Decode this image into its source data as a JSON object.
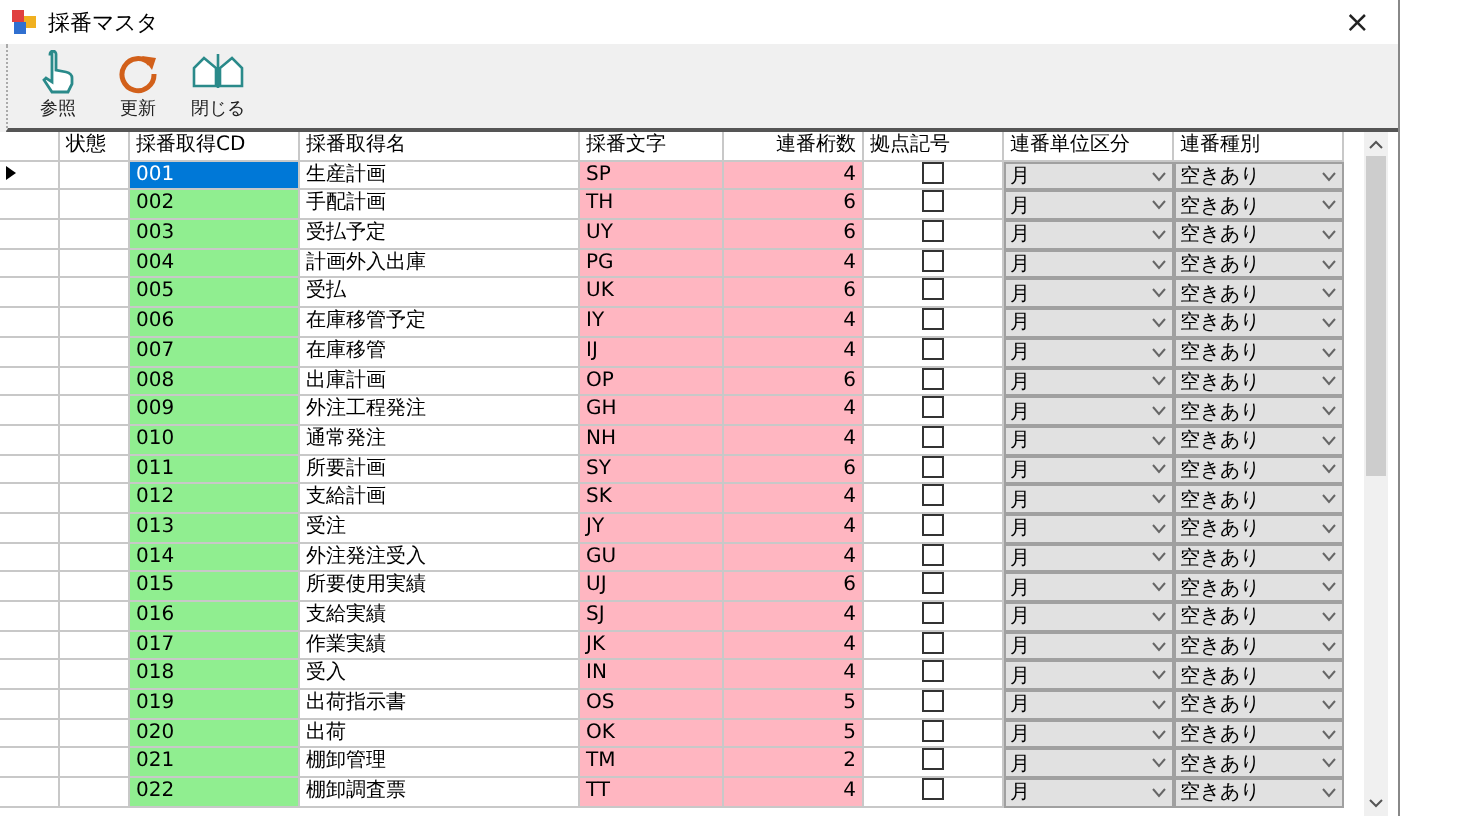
{
  "window": {
    "title": "採番マスタ",
    "close": "×"
  },
  "toolbar": [
    {
      "kind": "pointer",
      "label": "参照"
    },
    {
      "kind": "refresh",
      "label": "更新"
    },
    {
      "kind": "close",
      "label": "閉じる"
    }
  ],
  "table": {
    "columns": [
      "状態",
      "採番取得CD",
      "採番取得名",
      "採番文字",
      "連番桁数",
      "拠点記号",
      "連番単位区分",
      "連番種別"
    ],
    "rows": [
      {
        "selected": true,
        "code": "001",
        "name": "生産計画",
        "prefix": "SP",
        "digits": "4",
        "checked": false,
        "unit": "月",
        "type": "空きあり"
      },
      {
        "selected": false,
        "code": "002",
        "name": "手配計画",
        "prefix": "TH",
        "digits": "6",
        "checked": false,
        "unit": "月",
        "type": "空きあり"
      },
      {
        "selected": false,
        "code": "003",
        "name": "受払予定",
        "prefix": "UY",
        "digits": "6",
        "checked": false,
        "unit": "月",
        "type": "空きあり"
      },
      {
        "selected": false,
        "code": "004",
        "name": "計画外入出庫",
        "prefix": "PG",
        "digits": "4",
        "checked": false,
        "unit": "月",
        "type": "空きあり"
      },
      {
        "selected": false,
        "code": "005",
        "name": "受払",
        "prefix": "UK",
        "digits": "6",
        "checked": false,
        "unit": "月",
        "type": "空きあり"
      },
      {
        "selected": false,
        "code": "006",
        "name": "在庫移管予定",
        "prefix": "IY",
        "digits": "4",
        "checked": false,
        "unit": "月",
        "type": "空きあり"
      },
      {
        "selected": false,
        "code": "007",
        "name": "在庫移管",
        "prefix": "IJ",
        "digits": "4",
        "checked": false,
        "unit": "月",
        "type": "空きあり"
      },
      {
        "selected": false,
        "code": "008",
        "name": "出庫計画",
        "prefix": "OP",
        "digits": "6",
        "checked": false,
        "unit": "月",
        "type": "空きあり"
      },
      {
        "selected": false,
        "code": "009",
        "name": "外注工程発注",
        "prefix": "GH",
        "digits": "4",
        "checked": false,
        "unit": "月",
        "type": "空きあり"
      },
      {
        "selected": false,
        "code": "010",
        "name": "通常発注",
        "prefix": "NH",
        "digits": "4",
        "checked": false,
        "unit": "月",
        "type": "空きあり"
      },
      {
        "selected": false,
        "code": "011",
        "name": "所要計画",
        "prefix": "SY",
        "digits": "6",
        "checked": false,
        "unit": "月",
        "type": "空きあり"
      },
      {
        "selected": false,
        "code": "012",
        "name": "支給計画",
        "prefix": "SK",
        "digits": "4",
        "checked": false,
        "unit": "月",
        "type": "空きあり"
      },
      {
        "selected": false,
        "code": "013",
        "name": "受注",
        "prefix": "JY",
        "digits": "4",
        "checked": false,
        "unit": "月",
        "type": "空きあり"
      },
      {
        "selected": false,
        "code": "014",
        "name": "外注発注受入",
        "prefix": "GU",
        "digits": "4",
        "checked": false,
        "unit": "月",
        "type": "空きあり"
      },
      {
        "selected": false,
        "code": "015",
        "name": "所要使用実績",
        "prefix": "UJ",
        "digits": "6",
        "checked": false,
        "unit": "月",
        "type": "空きあり"
      },
      {
        "selected": false,
        "code": "016",
        "name": "支給実績",
        "prefix": "SJ",
        "digits": "4",
        "checked": false,
        "unit": "月",
        "type": "空きあり"
      },
      {
        "selected": false,
        "code": "017",
        "name": "作業実績",
        "prefix": "JK",
        "digits": "4",
        "checked": false,
        "unit": "月",
        "type": "空きあり"
      },
      {
        "selected": false,
        "code": "018",
        "name": "受入",
        "prefix": "IN",
        "digits": "4",
        "checked": false,
        "unit": "月",
        "type": "空きあり"
      },
      {
        "selected": false,
        "code": "019",
        "name": "出荷指示書",
        "prefix": "OS",
        "digits": "5",
        "checked": false,
        "unit": "月",
        "type": "空きあり"
      },
      {
        "selected": false,
        "code": "020",
        "name": "出荷",
        "prefix": "OK",
        "digits": "5",
        "checked": false,
        "unit": "月",
        "type": "空きあり"
      },
      {
        "selected": false,
        "code": "021",
        "name": "棚卸管理",
        "prefix": "TM",
        "digits": "2",
        "checked": false,
        "unit": "月",
        "type": "空きあり"
      },
      {
        "selected": false,
        "code": "022",
        "name": "棚卸調査票",
        "prefix": "TT",
        "digits": "4",
        "checked": false,
        "unit": "月",
        "type": "空きあり"
      }
    ]
  }
}
